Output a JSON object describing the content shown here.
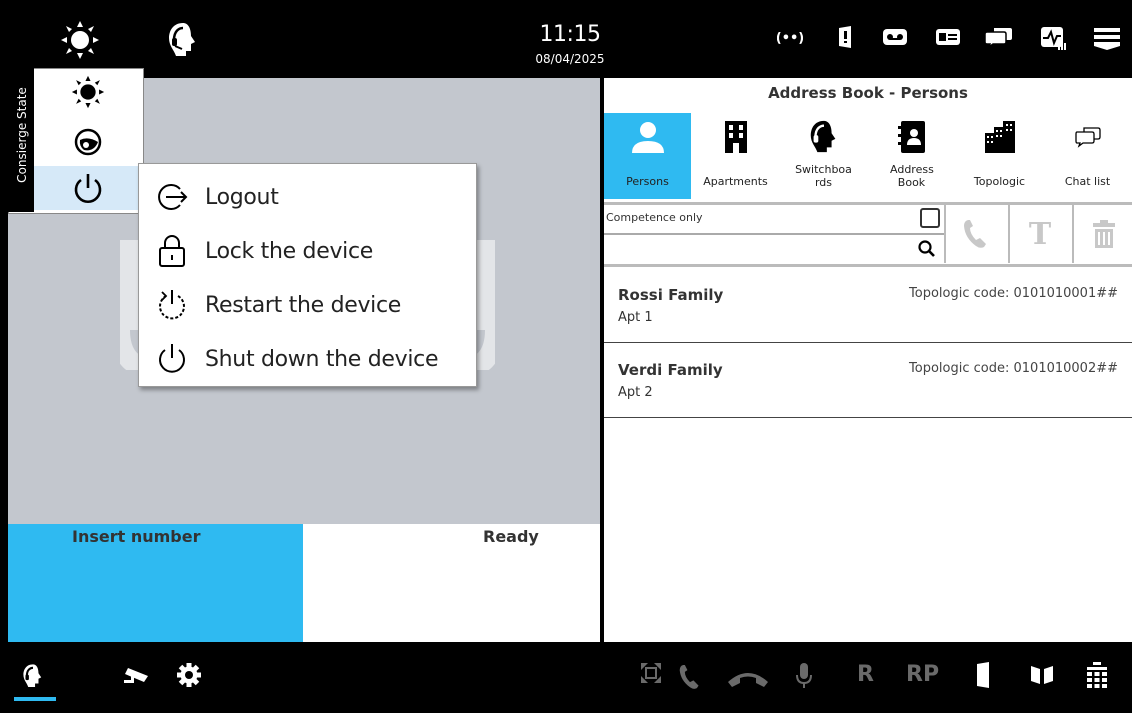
{
  "header": {
    "time": "11:15",
    "date": "08/04/2025"
  },
  "side_menu": {
    "label": "Consierge State"
  },
  "power_menu": {
    "items": [
      {
        "label": "Logout",
        "icon": "logout-icon"
      },
      {
        "label": "Lock the device",
        "icon": "lock-icon"
      },
      {
        "label": "Restart the device",
        "icon": "restart-icon"
      },
      {
        "label": "Shut down the device",
        "icon": "power-icon"
      }
    ]
  },
  "call_panel": {
    "insert_label": "Insert number",
    "status": "Ready"
  },
  "address_book": {
    "title": "Address Book - Persons",
    "tabs": [
      {
        "label": "Persons",
        "active": true
      },
      {
        "label": "Apartments"
      },
      {
        "label": "Switchboards"
      },
      {
        "label": "Address Book"
      },
      {
        "label": "Topologic"
      },
      {
        "label": "Chat list"
      }
    ],
    "filter": {
      "competence_label": "Competence only",
      "search_value": ""
    },
    "contacts": [
      {
        "name": "Rossi Family",
        "apt": "Apt 1",
        "code_label": "Topologic code:",
        "code": "0101010001##"
      },
      {
        "name": "Verdi Family",
        "apt": "Apt 2",
        "code_label": "Topologic code:",
        "code": "0101010002##"
      }
    ]
  },
  "bottom_bar": {
    "r_label": "R",
    "rp_label": "RP"
  },
  "colors": {
    "accent": "#2fbaf1",
    "panel_gray": "#c3c7ce",
    "disabled": "#6a6a6a"
  }
}
